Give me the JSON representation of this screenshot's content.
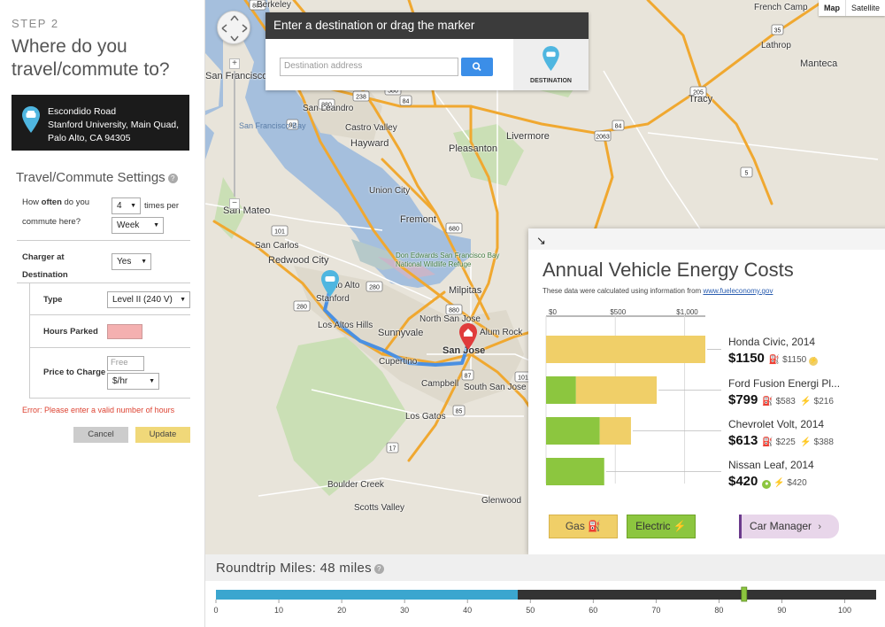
{
  "left": {
    "step": "STEP 2",
    "question": "Where do you travel/commute to?",
    "destination": {
      "line1": "Escondido Road",
      "line2": "Stanford University, Main Quad,",
      "line3": "Palo Alto, CA 94305"
    },
    "settings_title": "Travel/Commute Settings",
    "how_often_a": "How ",
    "how_often_b": "often",
    "how_often_c": " do you",
    "how_often_d": "commute here?",
    "times_value": "4",
    "times_per_a": "times per",
    "period_value": "Week",
    "charger_label_a": "Charger at",
    "charger_label_b": "Destination",
    "charger_value": "Yes",
    "type_label": "Type",
    "type_value": "Level II (240 V)",
    "hours_label": "Hours Parked",
    "price_label": "Price to Charge",
    "price_placeholder": "Free",
    "price_unit": "$/hr",
    "error": "Error: Please enter a valid number of hours",
    "cancel": "Cancel",
    "update": "Update"
  },
  "map": {
    "type_map": "Map",
    "type_satellite": "Satellite",
    "search": {
      "header": "Enter a destination or drag the marker",
      "placeholder": "Destination address",
      "dest_label": "DESTINATION"
    },
    "labels": {
      "berkeley": "Berkeley",
      "french_camp": "French Camp",
      "lathrop": "Lathrop",
      "manteca": "Manteca",
      "tracy": "Tracy",
      "san_francisco": "San Francisco",
      "san_francisco_bay": "San Francisco Bay",
      "san_leandro": "San Leandro",
      "castro_valley": "Castro Valley",
      "hayward": "Hayward",
      "livermore": "Livermore",
      "pleasanton": "Pleasanton",
      "union_city": "Union City",
      "fremont": "Fremont",
      "san_mateo": "San Mateo",
      "san_carlos": "San Carlos",
      "redwood_city": "Redwood City",
      "don_edwards": "Don Edwards San Francisco Bay National Wildlife Refuge",
      "palo_alto": "Palo Alto",
      "stanford": "Stanford",
      "milpitas": "Milpitas",
      "north_san_jose": "North San Jose",
      "los_altos_hills": "Los Altos Hills",
      "sunnyvale": "Sunnyvale",
      "alum_rock": "Alum Rock",
      "san_jose": "San Jose",
      "cupertino": "Cupertino",
      "campbell": "Campbell",
      "south_san_jose": "South San Jose",
      "los_gatos": "Los Gatos",
      "boulder_creek": "Boulder Creek",
      "scotts_valley": "Scotts Valley",
      "glenwood": "Glenwood"
    },
    "shields": [
      "880",
      "580",
      "680",
      "84",
      "205",
      "5",
      "580",
      "880",
      "238",
      "92",
      "101",
      "280",
      "280",
      "87",
      "101",
      "85",
      "680",
      "17",
      "880",
      "101",
      "262",
      "130",
      "84",
      "9",
      "35",
      "2063"
    ]
  },
  "cost_panel": {
    "title": "Annual Vehicle Energy Costs",
    "source_text": "These data were calculated using information from ",
    "source_link": "www.fueleconomy.gov",
    "vehicles": [
      {
        "name": "Honda Civic, 2014",
        "total": "$1150",
        "gas": "$1150",
        "electric": ""
      },
      {
        "name": "Ford Fusion Energi Pl...",
        "total": "$799",
        "gas": "$583",
        "electric": "$216"
      },
      {
        "name": "Chevrolet Volt, 2014",
        "total": "$613",
        "gas": "$225",
        "electric": "$388"
      },
      {
        "name": "Nissan Leaf, 2014",
        "total": "$420",
        "gas": "",
        "electric": "$420"
      }
    ],
    "gas_button": "Gas",
    "electric_button": "Electric",
    "car_manager_button": "Car Manager"
  },
  "chart_data": {
    "type": "bar",
    "orientation": "horizontal",
    "stacked": true,
    "categories": [
      "Honda Civic, 2014",
      "Ford Fusion Energi Pl...",
      "Chevrolet Volt, 2014",
      "Nissan Leaf, 2014"
    ],
    "series": [
      {
        "name": "Electric",
        "color": "#8cc63f",
        "values": [
          0,
          216,
          388,
          420
        ]
      },
      {
        "name": "Gas",
        "color": "#f0cf68",
        "values": [
          1150,
          583,
          225,
          0
        ]
      }
    ],
    "xticks": [
      "$0",
      "$500",
      "$1,000"
    ],
    "xlim": [
      0,
      1150
    ],
    "grid": true
  },
  "miles": {
    "title": "Roundtrip Miles: 48 miles",
    "value": 48,
    "max": 105,
    "marker": 84,
    "ticks": [
      0,
      10,
      20,
      30,
      40,
      50,
      60,
      70,
      80,
      90,
      100
    ],
    "fill_color": "#3ba6cf",
    "marker_color": "#8cc63f"
  }
}
